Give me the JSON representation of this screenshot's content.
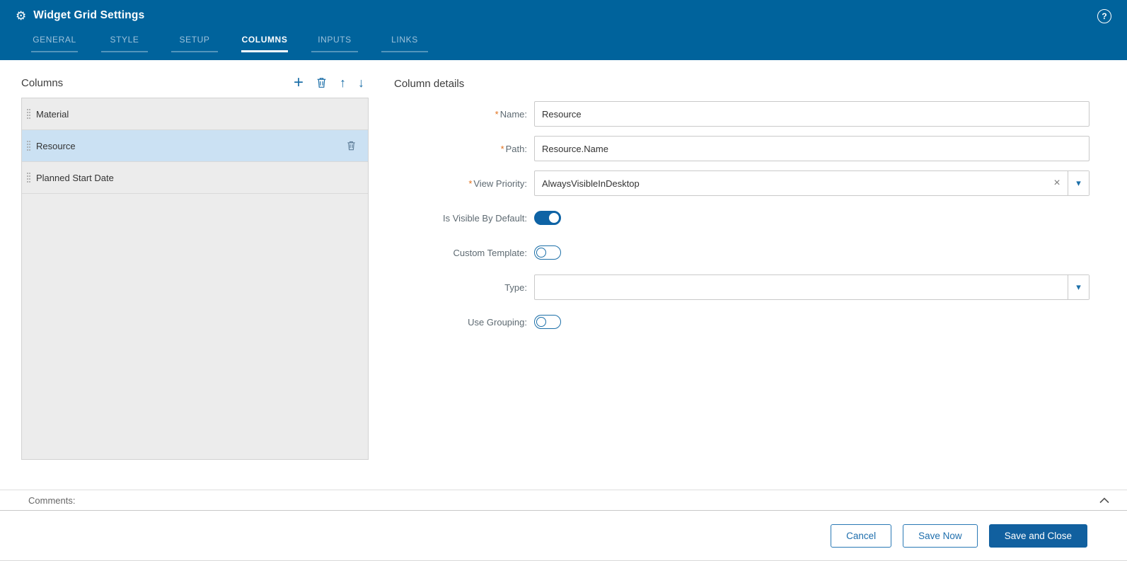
{
  "colors": {
    "header_bg": "#00639C",
    "accent": "#1C6FA8",
    "selected_row": "#CBE1F3",
    "required_marker_color": "#E2711D",
    "primary_button_bg": "#11609F"
  },
  "icons": {
    "gear": "⚙",
    "help": "?",
    "add": "+",
    "move_up": "↑",
    "move_down": "↓",
    "clear": "×",
    "dropdown": "▾",
    "required_marker": "*"
  },
  "header": {
    "title": "Widget Grid Settings",
    "tabs": [
      {
        "label": "GENERAL",
        "active": false
      },
      {
        "label": "STYLE",
        "active": false
      },
      {
        "label": "SETUP",
        "active": false
      },
      {
        "label": "COLUMNS",
        "active": true
      },
      {
        "label": "INPUTS",
        "active": false
      },
      {
        "label": "LINKS",
        "active": false
      }
    ]
  },
  "columns_panel": {
    "title": "Columns",
    "items": [
      {
        "label": "Material",
        "selected": false
      },
      {
        "label": "Resource",
        "selected": true
      },
      {
        "label": "Planned Start Date",
        "selected": false
      }
    ]
  },
  "details_panel": {
    "title": "Column details",
    "fields": {
      "name": {
        "label": "Name:",
        "required": true,
        "value": "Resource"
      },
      "path": {
        "label": "Path:",
        "required": true,
        "value": "Resource.Name"
      },
      "view_priority": {
        "label": "View Priority:",
        "required": true,
        "value": "AlwaysVisibleInDesktop"
      },
      "is_visible_by_default": {
        "label": "Is Visible By Default:",
        "on": true
      },
      "custom_template": {
        "label": "Custom Template:",
        "on": false
      },
      "type": {
        "label": "Type:",
        "value": ""
      },
      "use_grouping": {
        "label": "Use Grouping:",
        "on": false
      }
    }
  },
  "comments": {
    "label": "Comments:"
  },
  "footer": {
    "buttons": [
      {
        "label": "Cancel",
        "primary": false
      },
      {
        "label": "Save Now",
        "primary": false
      },
      {
        "label": "Save and Close",
        "primary": true
      }
    ]
  }
}
